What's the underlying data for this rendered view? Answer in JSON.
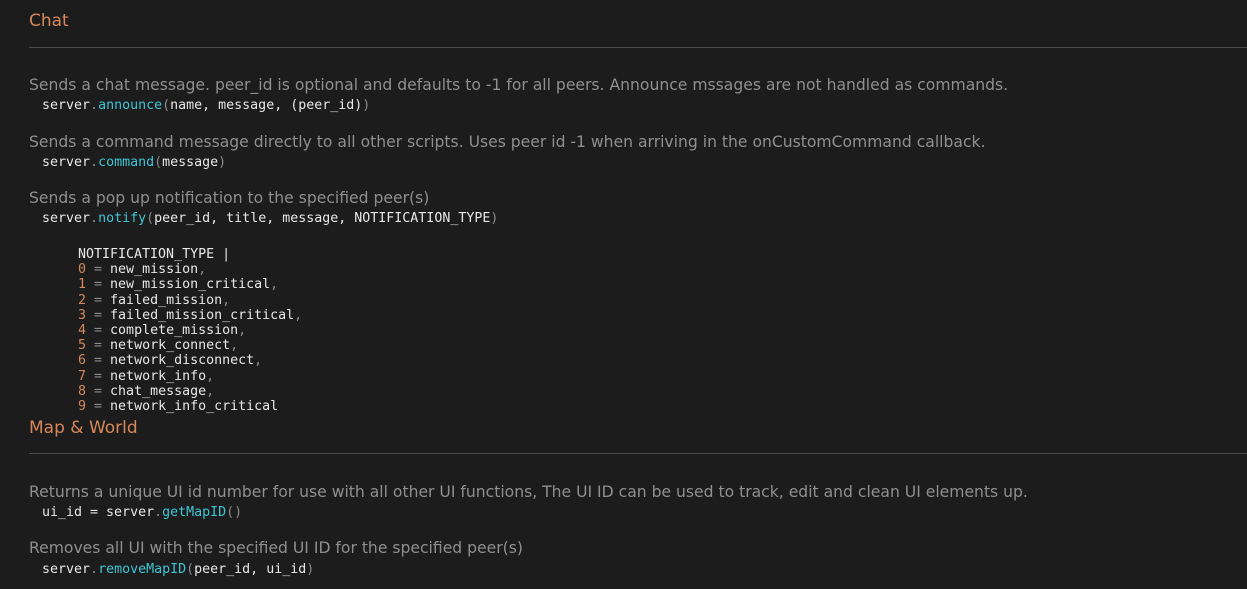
{
  "sections": {
    "chat": {
      "title": "Chat"
    },
    "map": {
      "title": "Map & World"
    }
  },
  "functions": {
    "announce": {
      "desc": "Sends a chat message. peer_id is optional and defaults to -1 for all peers. Announce mssages are not handled as commands.",
      "obj": "server",
      "dot": ".",
      "name": "announce",
      "open": "(",
      "args": "name, message, (peer_id)",
      "close": ")"
    },
    "command": {
      "desc": "Sends a command message directly to all other scripts. Uses peer id -1 when arriving in the onCustomCommand callback.",
      "obj": "server",
      "dot": ".",
      "name": "command",
      "open": "(",
      "args": "message",
      "close": ")"
    },
    "notify": {
      "desc": "Sends a pop up notification to the specified peer(s)",
      "obj": "server",
      "dot": ".",
      "name": "notify",
      "open": "(",
      "args": "peer_id, title, message, NOTIFICATION_TYPE",
      "close": ")"
    },
    "getMapID": {
      "desc": "Returns a unique UI id number for use with all other UI functions, The UI ID can be used to track, edit and clean UI elements up.",
      "lhs": "ui_id = ",
      "obj": "server",
      "dot": ".",
      "name": "getMapID",
      "open": "(",
      "args": "",
      "close": ")"
    },
    "removeMapID": {
      "desc": "Removes all UI with the specified UI ID for the specified peer(s)",
      "obj": "server",
      "dot": ".",
      "name": "removeMapID",
      "open": "(",
      "args": "peer_id, ui_id",
      "close": ")"
    }
  },
  "notification_type": {
    "header": "NOTIFICATION_TYPE |",
    "items": [
      {
        "num": "0",
        "eq": " = ",
        "name": "new_mission",
        "sep": ","
      },
      {
        "num": "1",
        "eq": " = ",
        "name": "new_mission_critical",
        "sep": ","
      },
      {
        "num": "2",
        "eq": " = ",
        "name": "failed_mission",
        "sep": ","
      },
      {
        "num": "3",
        "eq": " = ",
        "name": "failed_mission_critical",
        "sep": ","
      },
      {
        "num": "4",
        "eq": " = ",
        "name": "complete_mission",
        "sep": ","
      },
      {
        "num": "5",
        "eq": " = ",
        "name": "network_connect",
        "sep": ","
      },
      {
        "num": "6",
        "eq": " = ",
        "name": "network_disconnect",
        "sep": ","
      },
      {
        "num": "7",
        "eq": " = ",
        "name": "network_info",
        "sep": ","
      },
      {
        "num": "8",
        "eq": " = ",
        "name": "chat_message",
        "sep": ","
      },
      {
        "num": "9",
        "eq": " = ",
        "name": "network_info_critical",
        "sep": ""
      }
    ]
  },
  "colors": {
    "background": "#1c1c1c",
    "section_title": "#d6885a",
    "description": "#8f8f8f",
    "function_name": "#3cc7d6",
    "enum_number": "#d6885a"
  }
}
